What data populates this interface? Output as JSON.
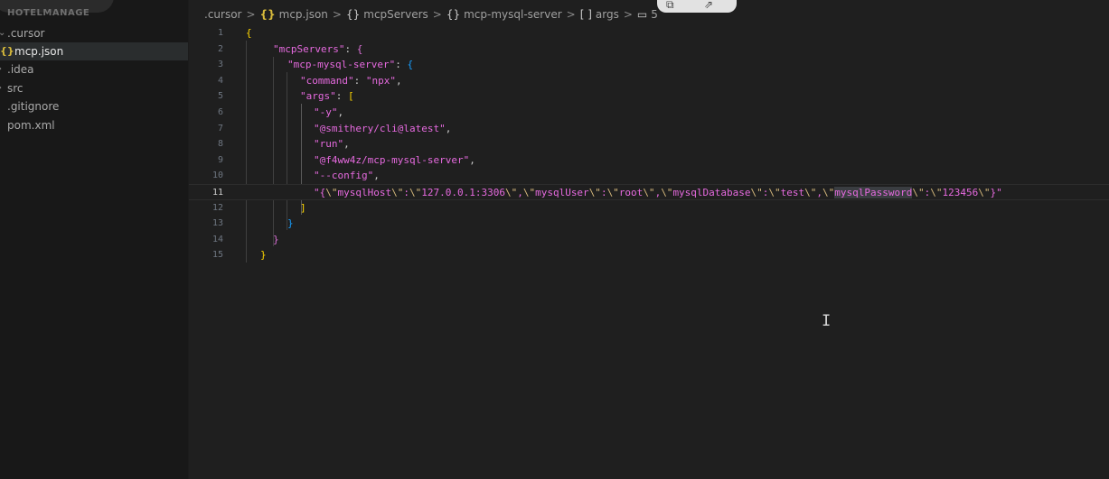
{
  "sidebar": {
    "project": "HOTELMANAGE",
    "items": [
      {
        "label": ".cursor",
        "type": "folder",
        "expanded": true
      },
      {
        "label": "mcp.json",
        "type": "json",
        "active": true
      },
      {
        "label": ".idea",
        "type": "folder"
      },
      {
        "label": "src",
        "type": "folder"
      },
      {
        "label": ".gitignore",
        "type": "file"
      },
      {
        "label": "pom.xml",
        "type": "file"
      }
    ]
  },
  "breadcrumb": {
    "items": [
      ".cursor",
      "mcp.json",
      "mcpServers",
      "mcp-mysql-server",
      "args",
      "5"
    ],
    "icons": [
      "json-icon",
      "braces-icon",
      "braces-icon",
      "array-icon",
      "string-icon"
    ]
  },
  "editor": {
    "current_line": 11,
    "lines": [
      {
        "n": "1",
        "tokens": [
          [
            "b1",
            "{"
          ]
        ]
      },
      {
        "n": "2",
        "tokens": [
          [
            "s-key",
            "\"mcpServers\""
          ],
          [
            "s-p",
            ": "
          ],
          [
            "b2",
            "{"
          ]
        ]
      },
      {
        "n": "3",
        "tokens": [
          [
            "s-key",
            "\"mcp-mysql-server\""
          ],
          [
            "s-p",
            ": "
          ],
          [
            "b3",
            "{"
          ]
        ]
      },
      {
        "n": "4",
        "tokens": [
          [
            "s-key",
            "\"command\""
          ],
          [
            "s-p",
            ": "
          ],
          [
            "s-str",
            "\"npx\""
          ],
          [
            "s-p",
            ","
          ]
        ]
      },
      {
        "n": "5",
        "tokens": [
          [
            "s-key",
            "\"args\""
          ],
          [
            "s-p",
            ": "
          ],
          [
            "b1",
            "["
          ]
        ]
      },
      {
        "n": "6",
        "tokens": [
          [
            "s-str",
            "\"-y\""
          ],
          [
            "s-p",
            ","
          ]
        ]
      },
      {
        "n": "7",
        "tokens": [
          [
            "s-str",
            "\"@smithery/cli@latest\""
          ],
          [
            "s-p",
            ","
          ]
        ]
      },
      {
        "n": "8",
        "tokens": [
          [
            "s-str",
            "\"run\""
          ],
          [
            "s-p",
            ","
          ]
        ]
      },
      {
        "n": "9",
        "tokens": [
          [
            "s-str",
            "\"@f4ww4z/mcp-mysql-server\""
          ],
          [
            "s-p",
            ","
          ]
        ]
      },
      {
        "n": "10",
        "tokens": [
          [
            "s-str",
            "\"--config\""
          ],
          [
            "s-p",
            ","
          ]
        ]
      },
      {
        "n": "11",
        "tokens": [
          [
            "s-str",
            "\"{"
          ],
          [
            "s-esc",
            "\\\""
          ],
          [
            "s-str",
            "mysqlHost"
          ],
          [
            "s-esc",
            "\\\""
          ],
          [
            "s-str",
            ":"
          ],
          [
            "s-esc",
            "\\\""
          ],
          [
            "s-str",
            "127.0.0.1:3306"
          ],
          [
            "s-esc",
            "\\\""
          ],
          [
            "s-str",
            ","
          ],
          [
            "s-esc",
            "\\\""
          ],
          [
            "s-str",
            "mysqlUser"
          ],
          [
            "s-esc",
            "\\\""
          ],
          [
            "s-str",
            ":"
          ],
          [
            "s-esc",
            "\\\""
          ],
          [
            "s-str",
            "root"
          ],
          [
            "s-esc",
            "\\\""
          ],
          [
            "s-str",
            ","
          ],
          [
            "s-esc",
            "\\\""
          ],
          [
            "s-str",
            "mysqlDatabase"
          ],
          [
            "s-esc",
            "\\\""
          ],
          [
            "s-str",
            ":"
          ],
          [
            "s-esc",
            "\\\""
          ],
          [
            "s-str",
            "test"
          ],
          [
            "s-esc",
            "\\\""
          ],
          [
            "s-str",
            ","
          ],
          [
            "s-esc",
            "\\\""
          ],
          [
            "hl s-str",
            "mysqlPassword"
          ],
          [
            "s-esc",
            "\\\""
          ],
          [
            "s-str",
            ":"
          ],
          [
            "s-esc",
            "\\\""
          ],
          [
            "s-str",
            "123456"
          ],
          [
            "s-esc",
            "\\\""
          ],
          [
            "s-str",
            "}\""
          ]
        ]
      },
      {
        "n": "12",
        "tokens": [
          [
            "b1",
            "]"
          ]
        ]
      },
      {
        "n": "13",
        "tokens": [
          [
            "b3",
            "}"
          ]
        ]
      },
      {
        "n": "14",
        "tokens": [
          [
            "b2",
            "}"
          ]
        ]
      },
      {
        "n": "15",
        "tokens": [
          [
            "b1",
            "}"
          ]
        ]
      }
    ]
  },
  "colors": {
    "editor_bg": "#1f1f1f",
    "sidebar_bg": "#181818",
    "string": "#e66adf",
    "bracket_gold": "#ffd700",
    "bracket_purple": "#da70d6",
    "bracket_blue": "#179fff"
  }
}
